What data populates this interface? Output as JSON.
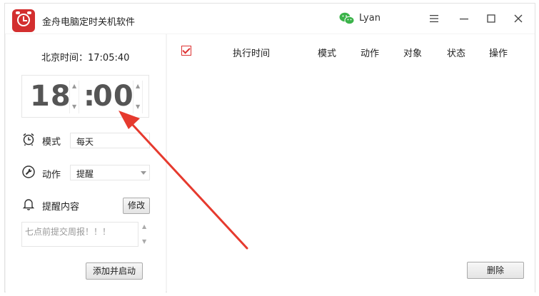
{
  "window": {
    "title": "金舟电脑定时关机软件",
    "user": "Lyan"
  },
  "left": {
    "clock_label": "北京时间：17:05:40",
    "hour": "18",
    "colon": ":",
    "minute": "00",
    "mode_label": "模式",
    "mode_value": "每天",
    "action_label": "动作",
    "action_value": "提醒",
    "remind_label": "提醒内容",
    "modify_button": "修改",
    "remind_text": "七点前提交周报！！！",
    "add_button": "添加并启动"
  },
  "table": {
    "checked": true,
    "columns": [
      "执行时间",
      "模式",
      "动作",
      "对象",
      "状态",
      "操作"
    ]
  },
  "delete_button": "删除",
  "colors": {
    "brand": "#d32f2f",
    "annotation_arrow": "#e63a2e",
    "wechat": "#3bb34a"
  }
}
